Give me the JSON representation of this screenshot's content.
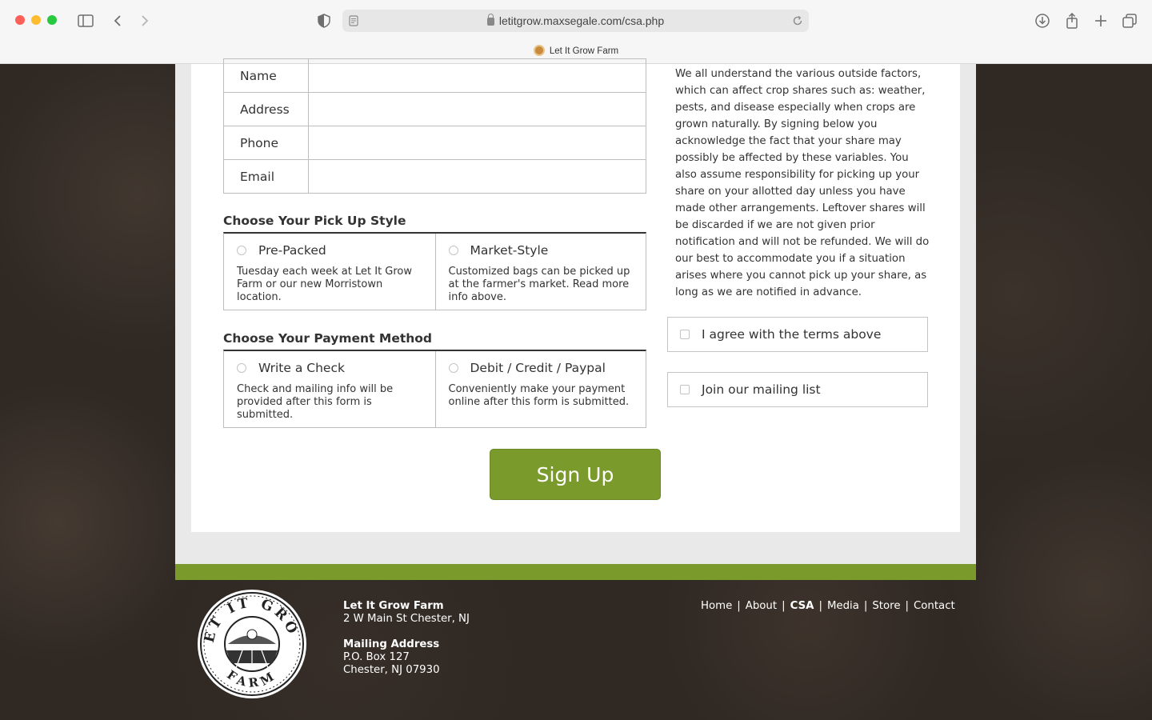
{
  "browser": {
    "url": "letitgrow.maxsegale.com/csa.php",
    "tab_title": "Let It Grow Farm"
  },
  "contact_form": {
    "rows": [
      {
        "label": "Name",
        "value": ""
      },
      {
        "label": "Address",
        "value": ""
      },
      {
        "label": "Phone",
        "value": ""
      },
      {
        "label": "Email",
        "value": ""
      }
    ]
  },
  "pickup": {
    "title": "Choose Your Pick Up Style",
    "options": [
      {
        "label": "Pre-Packed",
        "description": "Tuesday each week at Let It Grow Farm or our new Morristown location."
      },
      {
        "label": "Market-Style",
        "description": "Customized bags can be picked up at the farmer's market. Read more info above."
      }
    ]
  },
  "payment": {
    "title": "Choose Your Payment Method",
    "options": [
      {
        "label": "Write a Check",
        "description": "Check and mailing info will be provided after this form is submitted."
      },
      {
        "label": "Debit / Credit / Paypal",
        "description": "Conveniently make your payment online after this form is submitted."
      }
    ]
  },
  "terms": {
    "text": "We all understand the various outside factors, which can affect crop shares such as: weather, pests, and disease especially when crops are grown naturally. By signing below you acknowledge the fact that your share may possibly be affected by these variables. You also assume responsibility for picking up your share on your allotted day unless you have made other arrangements. Leftover shares will be discarded if we are not given prior notification and will not be refunded. We will do our best to accommodate you if a situation arises where you cannot pick up your share, as long as we are notified in advance.",
    "agree_label": "I agree with the terms above",
    "mailing_label": "Join our mailing list"
  },
  "signup_label": "Sign Up",
  "footer": {
    "logo_top": "LET IT GROW",
    "logo_bottom": "FARM",
    "name": "Let It Grow Farm",
    "street": "2 W Main St Chester, NJ",
    "mailing_title": "Mailing Address",
    "po_box": "P.O. Box 127",
    "city": "Chester, NJ 07930",
    "nav": [
      "Home",
      "About",
      "CSA",
      "Media",
      "Store",
      "Contact"
    ],
    "nav_active": "CSA"
  },
  "colors": {
    "accent_green": "#7a9a2c"
  }
}
